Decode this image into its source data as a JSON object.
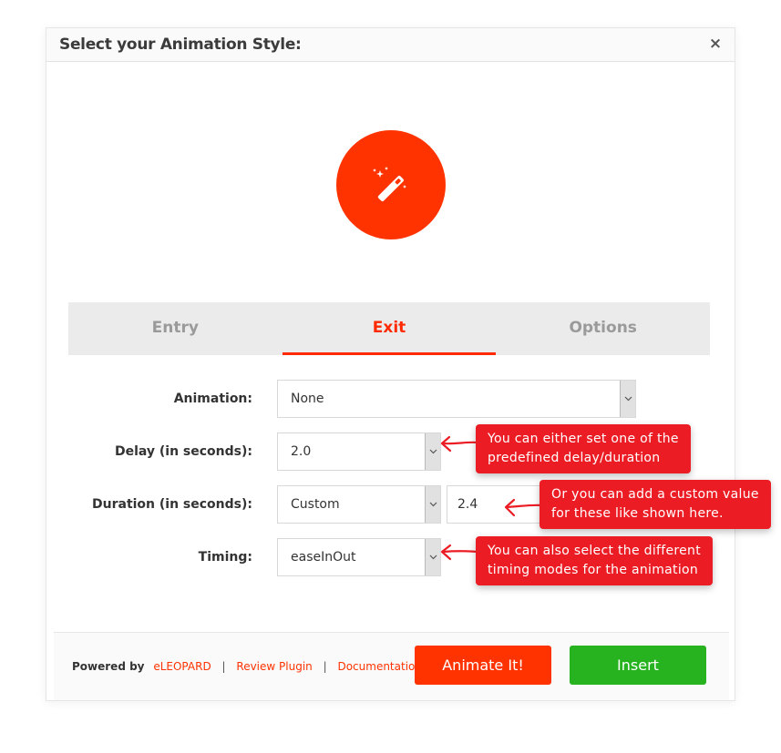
{
  "dialog": {
    "title": "Select your Animation Style:",
    "close_icon": "×",
    "hero_icon": "magic-wand-icon"
  },
  "tabs": [
    {
      "label": "Entry",
      "active": false
    },
    {
      "label": "Exit",
      "active": true
    },
    {
      "label": "Options",
      "active": false
    }
  ],
  "form": {
    "animation": {
      "label": "Animation:",
      "value": "None"
    },
    "delay": {
      "label": "Delay (in seconds):",
      "value": "2.0"
    },
    "duration": {
      "label": "Duration (in seconds):",
      "value": "Custom",
      "custom_value": "2.4"
    },
    "timing": {
      "label": "Timing:",
      "value": "easeInOut"
    }
  },
  "callouts": {
    "delay": {
      "line1": "You can either set one of the",
      "line2": "predefined delay/duration"
    },
    "custom": {
      "line1": "Or you can add a custom value",
      "line2": "for these like shown here."
    },
    "timing": {
      "line1": "You can also select the different",
      "line2": "timing modes for the animation"
    }
  },
  "footer": {
    "powered_by": "Powered by",
    "brand_link": "eLEOPARD",
    "separator": "|",
    "review_link": "Review Plugin",
    "docs_link": "Documentation",
    "animate_button": "Animate It!",
    "insert_button": "Insert"
  },
  "colors": {
    "accent": "#ff3300",
    "callout": "#ec1c24",
    "insert": "#27b21f"
  }
}
